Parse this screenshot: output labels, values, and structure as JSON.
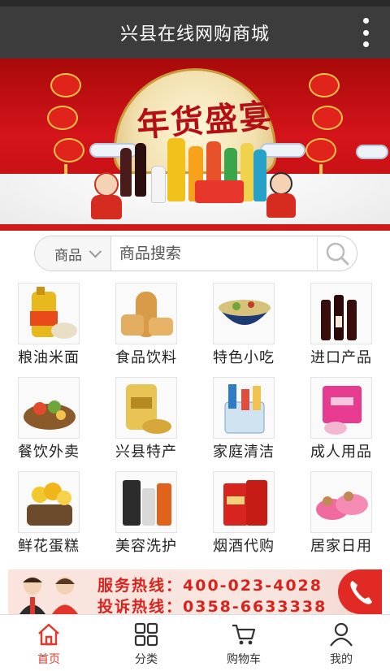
{
  "header": {
    "title": "兴县在线网购商城",
    "menu_icon": "more-vertical-icon"
  },
  "banner": {
    "slogan": "年货盛宴"
  },
  "search": {
    "category": "商品",
    "placeholder": "商品搜索",
    "icon": "search-icon"
  },
  "categories": [
    {
      "label": "粮油米面",
      "icon": "oil-rice-icon"
    },
    {
      "label": "食品饮料",
      "icon": "bread-icon"
    },
    {
      "label": "特色小吃",
      "icon": "noodle-bowl-icon"
    },
    {
      "label": "进口产品",
      "icon": "wine-bottles-icon"
    },
    {
      "label": "餐饮外卖",
      "icon": "food-platter-icon"
    },
    {
      "label": "兴县特产",
      "icon": "grain-bag-icon"
    },
    {
      "label": "家庭清洁",
      "icon": "cleaning-supplies-icon"
    },
    {
      "label": "成人用品",
      "icon": "pink-box-icon"
    },
    {
      "label": "鲜花蛋糕",
      "icon": "flower-cake-icon"
    },
    {
      "label": "美容洗护",
      "icon": "skincare-bottles-icon"
    },
    {
      "label": "烟酒代购",
      "icon": "cigarette-box-icon"
    },
    {
      "label": "居家日用",
      "icon": "slippers-icon"
    }
  ],
  "hotline": {
    "service": "服务热线：400-023-4028",
    "complaint": "投诉热线：0358-6633338",
    "accent": "#d9231e"
  },
  "tabbar": [
    {
      "label": "首页",
      "icon": "home-icon",
      "active": true
    },
    {
      "label": "分类",
      "icon": "grid-icon",
      "active": false
    },
    {
      "label": "购物车",
      "icon": "cart-icon",
      "active": false
    },
    {
      "label": "我的",
      "icon": "user-icon",
      "active": false
    }
  ],
  "colors": {
    "header_bg": "#3c3c3c",
    "accent": "#e23a2e",
    "banner_red": "#d4141a"
  }
}
